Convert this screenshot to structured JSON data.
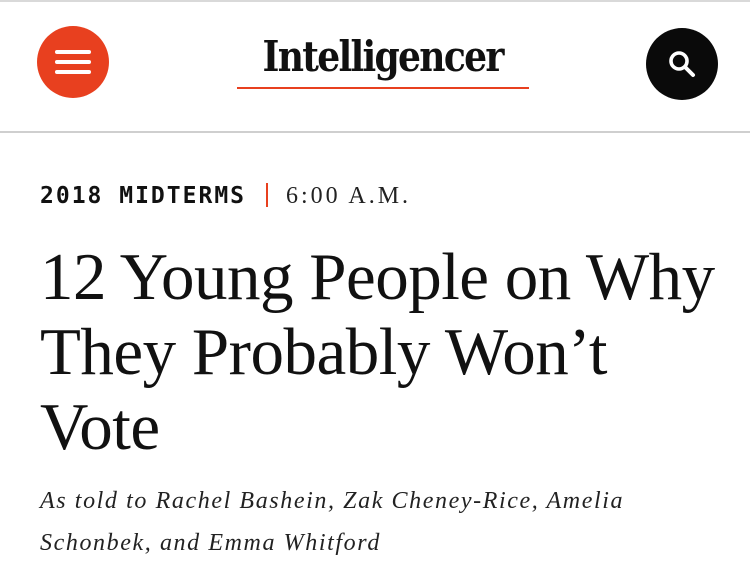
{
  "header": {
    "logo_text": "Intelligencer",
    "menu_icon": "hamburger-menu-icon",
    "search_icon": "magnifying-glass-icon",
    "accent_color": "#e8401f"
  },
  "article": {
    "rubric": "2018 MIDTERMS",
    "timestamp": "6:00 A.M.",
    "headline": "12 Young People on Why They Probably Won’t Vote",
    "byline": "As told to Rachel Bashein, Zak Cheney-Rice, Amelia Schonbek, and Emma Whitford"
  }
}
